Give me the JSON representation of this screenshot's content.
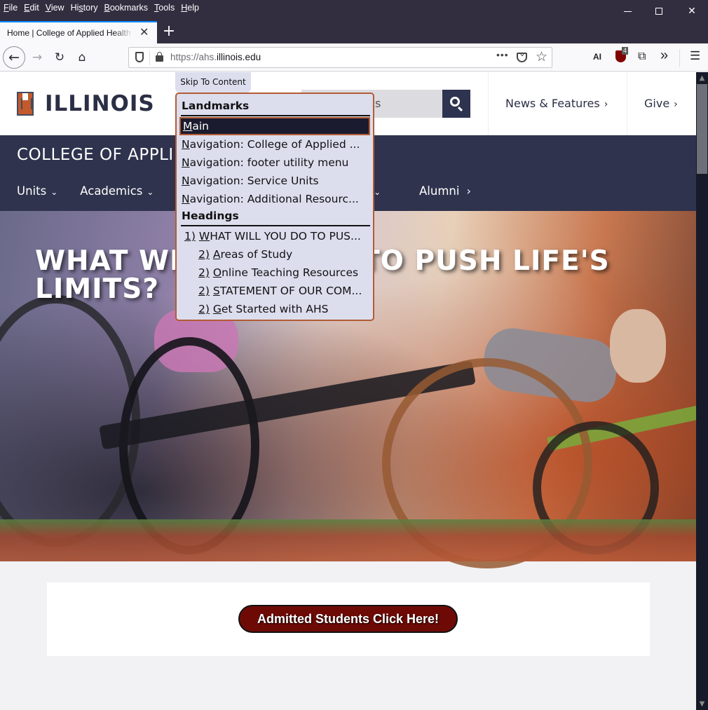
{
  "browser": {
    "menu": [
      {
        "key": "F",
        "rest": "ile"
      },
      {
        "key": "E",
        "rest": "dit"
      },
      {
        "key": "V",
        "rest": "iew"
      },
      {
        "pre": "Hi",
        "key": "s",
        "rest": "tory"
      },
      {
        "key": "B",
        "rest": "ookmarks"
      },
      {
        "key": "T",
        "rest": "ools"
      },
      {
        "key": "H",
        "rest": "elp"
      }
    ],
    "menu_labels": [
      "File",
      "Edit",
      "View",
      "History",
      "Bookmarks",
      "Tools",
      "Help"
    ],
    "tab": {
      "title": "Home | College of Applied Health Sciences",
      "close": "✕"
    },
    "new_tab": "+",
    "url": {
      "prefix": "https://ahs.",
      "domain": "illinois.edu"
    },
    "page_actions": "•••",
    "ext_ai_label": "AI",
    "ublock_badge": "4",
    "overflow": "»",
    "menu_icon": "☰",
    "back": "←",
    "forward": "→",
    "reload": "↻",
    "home": "⌂"
  },
  "site": {
    "logo_text": "ILLINOIS",
    "search_placeholder": "s",
    "header_links": [
      {
        "label": "News & Features",
        "chevron": "›"
      },
      {
        "label": "Give",
        "chevron": "›"
      }
    ],
    "college_title": "COLLEGE OF APPLIED HEALTH SCIENCES",
    "nav": [
      {
        "label": "Units",
        "chevron": "⌄"
      },
      {
        "label": "Academics",
        "chevron": "⌄"
      }
    ],
    "nav_partial": "e",
    "nav_partial_chevron": "⌄",
    "nav_alumni": {
      "label": "Alumni",
      "chevron": "›"
    },
    "hero_title": "WHAT WILL YOU DO TO PUSH LIFE'S LIMITS?",
    "cta_label": "Admitted Students Click Here!"
  },
  "skip_to": {
    "button_label": "Skip To Content",
    "landmarks_label": "Landmarks",
    "landmarks": [
      {
        "key": "M",
        "rest": "ain",
        "active": true
      },
      {
        "key": "N",
        "rest": "avigation: College of Applied ..."
      },
      {
        "key": "N",
        "rest": "avigation: footer utility menu"
      },
      {
        "key": "N",
        "rest": "avigation: Service Units"
      },
      {
        "key": "N",
        "rest": "avigation: Additional Resourc..."
      }
    ],
    "headings_label": "Headings",
    "headings": [
      {
        "level": "1)",
        "key": "W",
        "rest": "HAT WILL YOU DO TO PUS..."
      },
      {
        "level": "2)",
        "key": "A",
        "rest": "reas of Study"
      },
      {
        "level": "2)",
        "key": "O",
        "rest": "nline Teaching Resources"
      },
      {
        "level": "2)",
        "key": "S",
        "rest": "TATEMENT OF OUR COM..."
      },
      {
        "level": "2)",
        "key": "G",
        "rest": "et Started with AHS"
      }
    ]
  },
  "colors": {
    "illinois_orange": "#c35a2b",
    "illinois_blue": "#2f334d",
    "cta_red": "#6e0a06",
    "skipto_border": "#b35b34",
    "skipto_bg": "#dcdeee"
  }
}
